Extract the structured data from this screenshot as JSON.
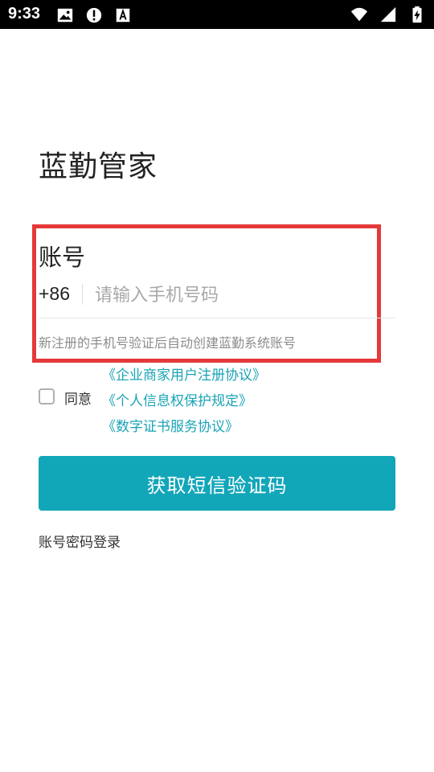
{
  "status_bar": {
    "time": "9:33",
    "left_icons": [
      "image-icon",
      "alert-icon",
      "font-a-icon"
    ],
    "right_icons": [
      "wifi-icon",
      "signal-icon",
      "battery-charging-icon"
    ]
  },
  "app": {
    "title": "蓝勤管家"
  },
  "login_form": {
    "account_label": "账号",
    "country_code": "+86",
    "phone_placeholder": "请输入手机号码",
    "phone_value": "",
    "hint": "新注册的手机号验证后自动创建蓝勤系统账号"
  },
  "agreement": {
    "checked": false,
    "agree_label": "同意",
    "links": [
      "《企业商家用户注册协议》",
      "《个人信息权保护规定》",
      "《数字证书服务协议》"
    ]
  },
  "actions": {
    "get_code_label": "获取短信验证码",
    "password_login_label": "账号密码登录"
  },
  "colors": {
    "accent": "#12a6b9",
    "link": "#19a3b5",
    "highlight_border": "#e53939",
    "status_bar_bg": "#000000"
  }
}
